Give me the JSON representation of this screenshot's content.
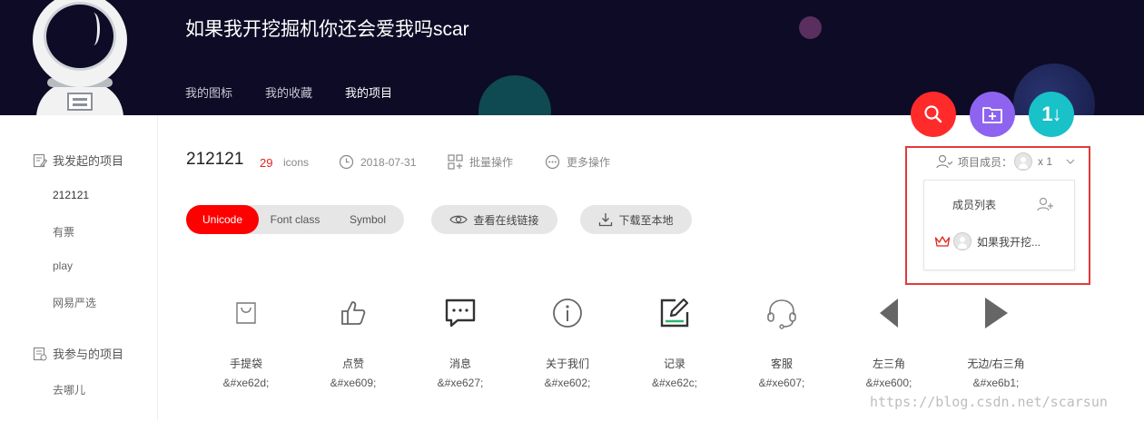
{
  "header": {
    "title": "如果我开挖掘机你还会爱我吗scar",
    "tabs": [
      {
        "label": "我的图标",
        "active": false
      },
      {
        "label": "我的收藏",
        "active": false
      },
      {
        "label": "我的项目",
        "active": true
      }
    ]
  },
  "actions": {
    "search_icon": "search-icon",
    "add_folder_icon": "add-folder-icon",
    "sort_label": "1↓"
  },
  "sidebar": {
    "created_heading": "我发起的项目",
    "created_items": [
      "212121",
      "有票",
      "play",
      "网易严选"
    ],
    "joined_heading": "我参与的项目",
    "joined_items": [
      "去哪儿"
    ]
  },
  "project": {
    "name": "212121",
    "count": "29",
    "count_unit": "icons",
    "date": "2018-07-31",
    "batch_label": "批量操作",
    "more_label": "更多操作"
  },
  "formats": {
    "options": [
      "Unicode",
      "Font class",
      "Symbol"
    ],
    "selected": "Unicode"
  },
  "buttons": {
    "view_online": "查看在线链接",
    "download": "下载至本地"
  },
  "members": {
    "label": "项目成员：",
    "count": "x 1",
    "list_title": "成员列表",
    "list": [
      {
        "name": "如果我开挖...",
        "role": "owner"
      }
    ]
  },
  "icons": [
    {
      "name": "手提袋",
      "code": "&#xe62d;",
      "icon": "shopping-bag-icon"
    },
    {
      "name": "点赞",
      "code": "&#xe609;",
      "icon": "thumbs-up-icon"
    },
    {
      "name": "消息",
      "code": "&#xe627;",
      "icon": "message-icon"
    },
    {
      "name": "关于我们",
      "code": "&#xe602;",
      "icon": "info-icon"
    },
    {
      "name": "记录",
      "code": "&#xe62c;",
      "icon": "record-edit-icon"
    },
    {
      "name": "客服",
      "code": "&#xe607;",
      "icon": "headset-icon"
    },
    {
      "name": "左三角",
      "code": "&#xe600;",
      "icon": "triangle-left-icon"
    },
    {
      "name": "无边/右三角",
      "code": "&#xe6b1;",
      "icon": "triangle-right-icon"
    }
  ],
  "watermark": "https://blog.csdn.net/scarsun",
  "colors": {
    "header_bg": "#0d0b26",
    "accent_red": "#ff0000",
    "search_fab": "#ff2b2b",
    "folder_fab": "#8e63f0",
    "sort_fab": "#19c1c8",
    "icon_gray": "#666666"
  }
}
